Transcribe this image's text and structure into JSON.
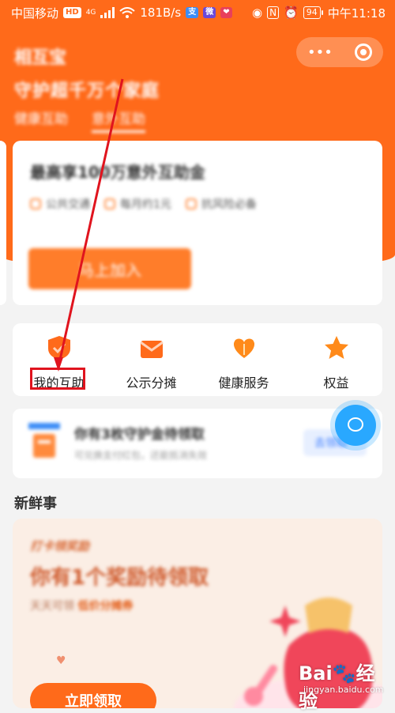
{
  "status_bar": {
    "carrier": "中国移动",
    "hd_badge": "HD",
    "net_type": "4G",
    "speed": "181B/s",
    "nfc": "N",
    "battery": "94",
    "time": "中午11:18"
  },
  "header": {
    "app_title": "相互宝",
    "capsule_more": "•••",
    "slogan": "守护超千万个家庭",
    "tabs": [
      {
        "label": "健康互助"
      },
      {
        "label": "意外互助"
      }
    ]
  },
  "main_card": {
    "headline": "最高享100万意外互助金",
    "perks": [
      "公共交通",
      "每月约1元",
      "抗风险必备"
    ],
    "join_button": "马上加入"
  },
  "icon_row": {
    "items": [
      {
        "label": "我的互助",
        "icon": "shield-icon",
        "color": "#ff6a1a"
      },
      {
        "label": "公示分摊",
        "icon": "envelope-icon",
        "color": "#ff6a1a"
      },
      {
        "label": "健康服务",
        "icon": "heart-leaf-icon",
        "color": "#ff8a1a"
      },
      {
        "label": "权益",
        "icon": "star-icon",
        "color": "#ff8a1a"
      }
    ]
  },
  "notice": {
    "title": "你有3枚守护金待领取",
    "subtitle": "可兑换支付红包，还能抵消失效",
    "button": "去领取"
  },
  "section": {
    "title": "新鲜事"
  },
  "promo": {
    "tag": "打卡领奖励",
    "headline": "你有1个奖励待领取",
    "sub_prefix": "天天可领",
    "sub_highlight": "低价分摊券",
    "claim_button": "立即领取"
  },
  "watermark": {
    "brand": "Bai🐾经验",
    "url": "jingyan.baidu.com"
  },
  "colors": {
    "primary": "#ff6a1a",
    "highlight_box": "#e0141e",
    "arrow": "#e0141e"
  }
}
